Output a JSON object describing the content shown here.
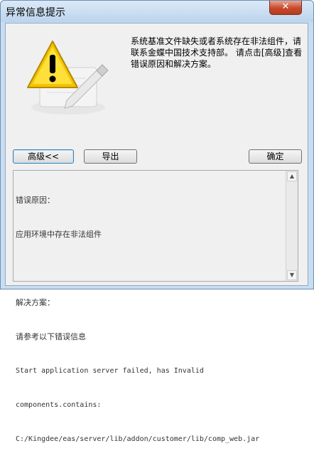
{
  "window": {
    "title": "异常信息提示",
    "close_glyph": "✕"
  },
  "message": "系统基准文件缺失或者系统存在非法组件，请联系金蝶中国技术支持部。 请点击[高级]查看错误原因和解决方案。",
  "buttons": {
    "advanced": "高级<<",
    "export": "导出",
    "ok": "确定"
  },
  "details": {
    "cause_header": "错误原因：",
    "cause": "应用环境中存在非法组件",
    "solution_header": "解决方案：",
    "solution_lines": [
      "请参考以下错误信息",
      "Start application server failed, has Invalid",
      "components.contains:",
      "C:/Kingdee/eas/server/lib/addon/customer/lib/comp_web.jar"
    ]
  },
  "icons": {
    "warning": "warning-icon",
    "pen": "pen-icon",
    "scroll_up": "▲",
    "scroll_down": "▼"
  }
}
